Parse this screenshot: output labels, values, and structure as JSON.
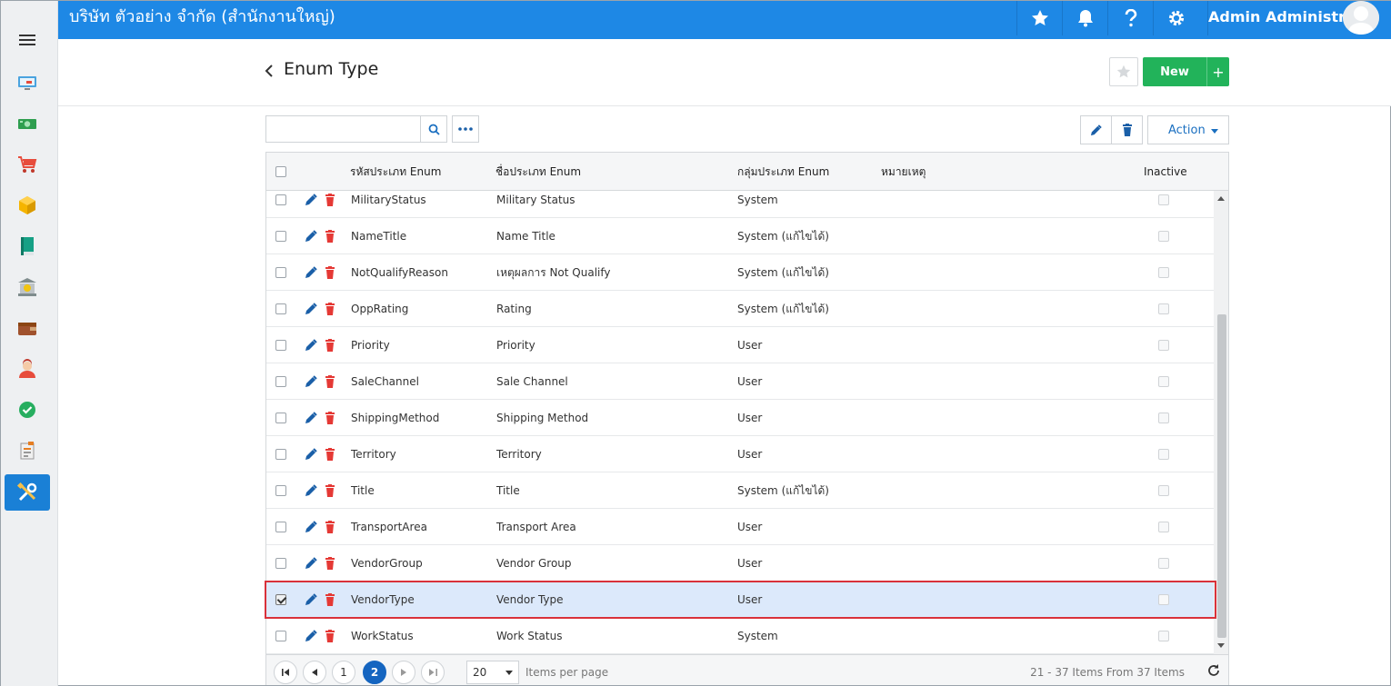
{
  "header": {
    "company": "บริษัท ตัวอย่าง จำกัด (สำนักงานใหญ่)",
    "user_name": "Admin Administr...",
    "icons": [
      "star-icon",
      "bell-icon",
      "help-icon",
      "gear-icon"
    ],
    "color": "#1e88e5"
  },
  "sidebar": {
    "items": [
      {
        "icon": "monitor-icon"
      },
      {
        "icon": "money-icon"
      },
      {
        "icon": "cart-icon"
      },
      {
        "icon": "box-icon"
      },
      {
        "icon": "book-icon"
      },
      {
        "icon": "bank-icon"
      },
      {
        "icon": "wallet-icon"
      },
      {
        "icon": "person-icon"
      },
      {
        "icon": "check-icon"
      },
      {
        "icon": "report-icon"
      },
      {
        "icon": "tools-icon",
        "active": true
      }
    ]
  },
  "page": {
    "title": "Enum Type",
    "new_label": "New",
    "new_plus": "+",
    "action_label": "Action",
    "search_placeholder": "",
    "accent": "#22b35a"
  },
  "grid": {
    "columns": {
      "code": "รหัสประเภท Enum",
      "name": "ชื่อประเภท Enum",
      "group": "กลุ่มประเภท Enum",
      "note": "หมายเหตุ",
      "inactive": "Inactive"
    },
    "rows": [
      {
        "code": "MilitaryStatus",
        "name": "Military Status",
        "group": "System",
        "selected": false
      },
      {
        "code": "NameTitle",
        "name": "Name Title",
        "group": "System (แก้ไขได้)",
        "selected": false
      },
      {
        "code": "NotQualifyReason",
        "name": "เหตุผลการ Not Qualify",
        "group": "System (แก้ไขได้)",
        "selected": false
      },
      {
        "code": "OppRating",
        "name": "Rating",
        "group": "System (แก้ไขได้)",
        "selected": false
      },
      {
        "code": "Priority",
        "name": "Priority",
        "group": "User",
        "selected": false
      },
      {
        "code": "SaleChannel",
        "name": "Sale Channel",
        "group": "User",
        "selected": false
      },
      {
        "code": "ShippingMethod",
        "name": "Shipping Method",
        "group": "User",
        "selected": false
      },
      {
        "code": "Territory",
        "name": "Territory",
        "group": "User",
        "selected": false
      },
      {
        "code": "Title",
        "name": "Title",
        "group": "System (แก้ไขได้)",
        "selected": false
      },
      {
        "code": "TransportArea",
        "name": "Transport Area",
        "group": "User",
        "selected": false
      },
      {
        "code": "VendorGroup",
        "name": "Vendor Group",
        "group": "User",
        "selected": false
      },
      {
        "code": "VendorType",
        "name": "Vendor Type",
        "group": "User",
        "selected": true
      },
      {
        "code": "WorkStatus",
        "name": "Work Status",
        "group": "System",
        "selected": false
      }
    ],
    "selected_color": "#dce9fb",
    "highlight_color": "#d9313a"
  },
  "pager": {
    "pages": [
      "1",
      "2"
    ],
    "current": "2",
    "page_size": "20",
    "items_per_page_label": "Items per page",
    "info": "21 - 37 Items From 37 Items"
  }
}
